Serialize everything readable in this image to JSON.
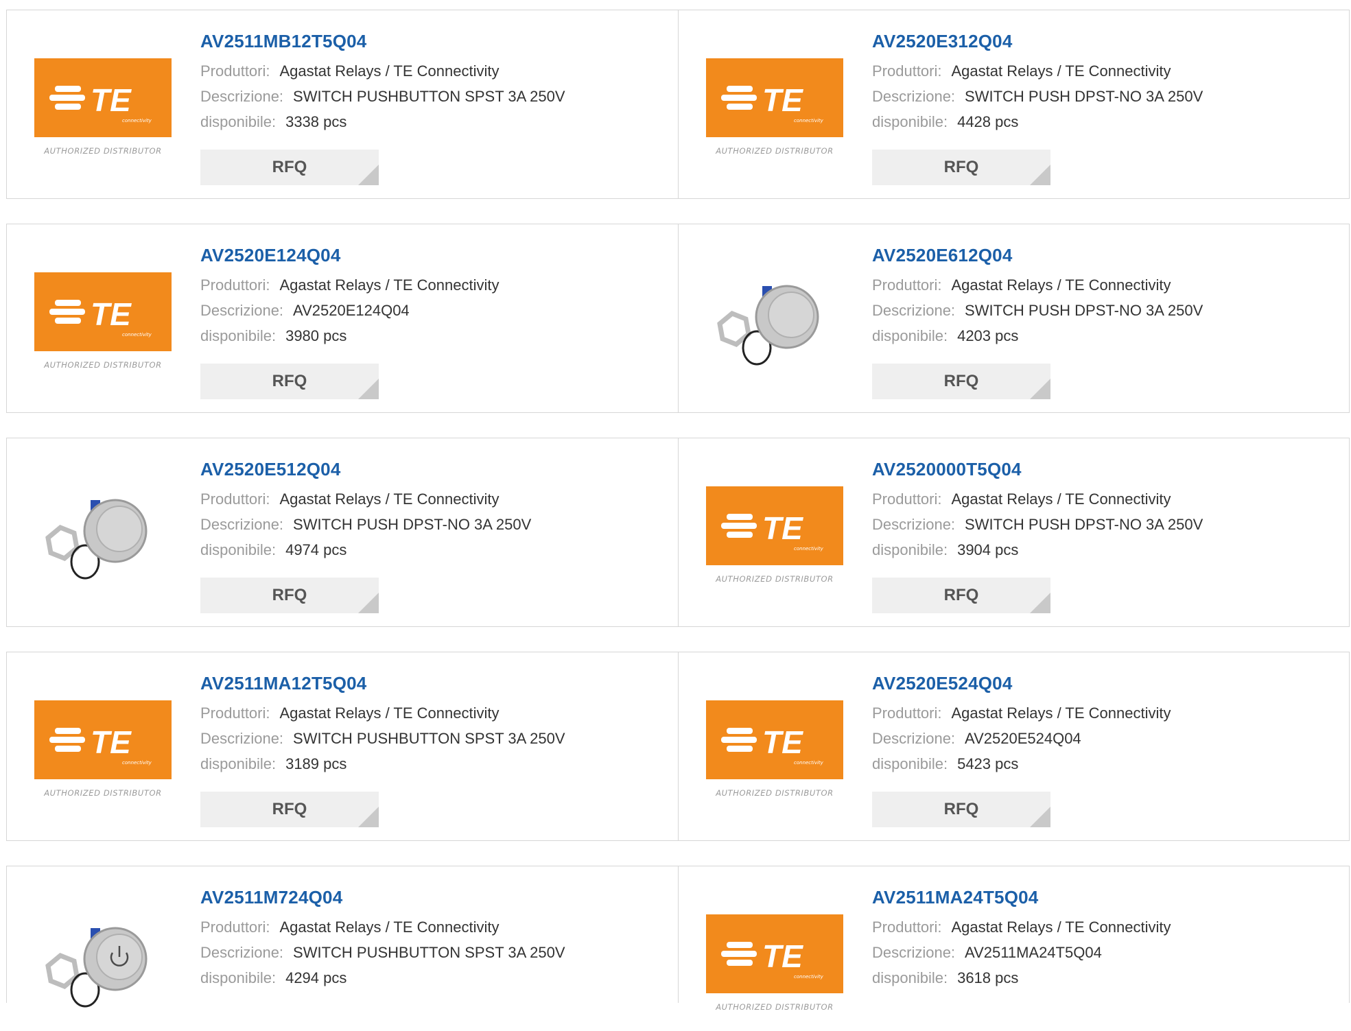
{
  "labels": {
    "manufacturer": "Produttori:",
    "description": "Descrizione:",
    "available": "disponibile:",
    "rfq": "RFQ",
    "te_caption": "AUTHORIZED DISTRIBUTOR",
    "te_logo_text": "TE",
    "te_logo_sub": "connectivity"
  },
  "colors": {
    "link": "#1b5fa8",
    "te_orange": "#f28a1c",
    "label_gray": "#9a9a9a"
  },
  "products": [
    {
      "part": "AV2511MB12T5Q04",
      "manufacturer": "Agastat Relays / TE Connectivity",
      "description": "SWITCH PUSHBUTTON SPST 3A 250V",
      "available": "3338 pcs",
      "image": "te-logo"
    },
    {
      "part": "AV2520E312Q04",
      "manufacturer": "Agastat Relays / TE Connectivity",
      "description": "SWITCH PUSH DPST-NO 3A 250V",
      "available": "4428 pcs",
      "image": "te-logo"
    },
    {
      "part": "AV2520E124Q04",
      "manufacturer": "Agastat Relays / TE Connectivity",
      "description": "AV2520E124Q04",
      "available": "3980 pcs",
      "image": "te-logo"
    },
    {
      "part": "AV2520E612Q04",
      "manufacturer": "Agastat Relays / TE Connectivity",
      "description": "SWITCH PUSH DPST-NO 3A 250V",
      "available": "4203 pcs",
      "image": "pushbutton-photo"
    },
    {
      "part": "AV2520E512Q04",
      "manufacturer": "Agastat Relays / TE Connectivity",
      "description": "SWITCH PUSH DPST-NO 3A 250V",
      "available": "4974 pcs",
      "image": "pushbutton-photo"
    },
    {
      "part": "AV2520000T5Q04",
      "manufacturer": "Agastat Relays / TE Connectivity",
      "description": "SWITCH PUSH DPST-NO 3A 250V",
      "available": "3904 pcs",
      "image": "te-logo"
    },
    {
      "part": "AV2511MA12T5Q04",
      "manufacturer": "Agastat Relays / TE Connectivity",
      "description": "SWITCH PUSHBUTTON SPST 3A 250V",
      "available": "3189 pcs",
      "image": "te-logo"
    },
    {
      "part": "AV2520E524Q04",
      "manufacturer": "Agastat Relays / TE Connectivity",
      "description": "AV2520E524Q04",
      "available": "5423 pcs",
      "image": "te-logo"
    },
    {
      "part": "AV2511M724Q04",
      "manufacturer": "Agastat Relays / TE Connectivity",
      "description": "SWITCH PUSHBUTTON SPST 3A 250V",
      "available": "4294 pcs",
      "image": "power-pushbutton-photo"
    },
    {
      "part": "AV2511MA24T5Q04",
      "manufacturer": "Agastat Relays / TE Connectivity",
      "description": "AV2511MA24T5Q04",
      "available": "3618 pcs",
      "image": "te-logo"
    }
  ]
}
